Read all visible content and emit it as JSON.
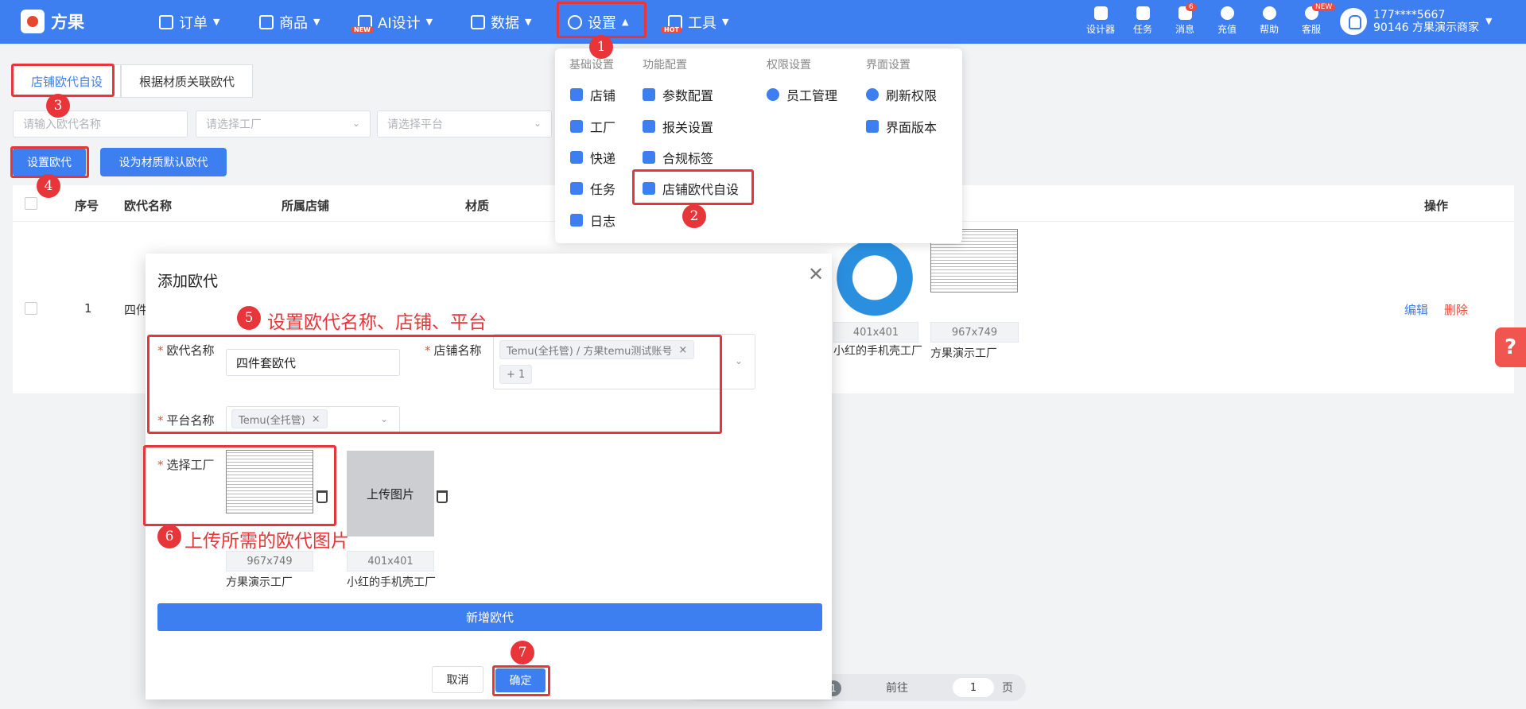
{
  "app": {
    "name": "方果"
  },
  "nav": {
    "items": [
      {
        "label": "订单"
      },
      {
        "label": "商品"
      },
      {
        "label": "AI设计",
        "badge": "NEW"
      },
      {
        "label": "数据"
      },
      {
        "label": "设置"
      },
      {
        "label": "工具",
        "badge": "HOT"
      }
    ],
    "right": [
      {
        "label": "设计器"
      },
      {
        "label": "任务"
      },
      {
        "label": "消息",
        "count": "6"
      },
      {
        "label": "充值"
      },
      {
        "label": "帮助"
      },
      {
        "label": "客服",
        "badge": "NEW"
      }
    ],
    "user": {
      "phone": "177****5667",
      "store": "90146 方果演示商家"
    }
  },
  "tabs": [
    "店铺欧代自设",
    "根据材质关联欧代"
  ],
  "filters": {
    "name_placeholder": "请输入欧代名称",
    "factory_placeholder": "请选择工厂",
    "platform_placeholder": "请选择平台"
  },
  "buttons": {
    "set_rep": "设置欧代",
    "set_default": "设为材质默认欧代"
  },
  "table": {
    "headers": [
      "序号",
      "欧代名称",
      "所属店铺",
      "材质",
      "操作"
    ],
    "row": {
      "index": "1",
      "name": "四件",
      "edit": "编辑",
      "delete": "删除",
      "images": [
        {
          "size": "401x401",
          "factory": "小红的手机壳工厂"
        },
        {
          "size": "967x749",
          "factory": "方果演示工厂"
        }
      ]
    }
  },
  "pager": {
    "page": "1",
    "goto_label": "前往",
    "goto_value": "1",
    "page_suffix": "页"
  },
  "menu": {
    "columns": [
      {
        "title": "基础设置",
        "items": [
          "店铺",
          "工厂",
          "快递",
          "任务",
          "日志"
        ]
      },
      {
        "title": "功能配置",
        "items": [
          "参数配置",
          "报关设置",
          "合规标签",
          "店铺欧代自设"
        ]
      },
      {
        "title": "权限设置",
        "items": [
          "员工管理"
        ]
      },
      {
        "title": "界面设置",
        "items": [
          "刷新权限",
          "界面版本"
        ]
      }
    ]
  },
  "dialog": {
    "title": "添加欧代",
    "rep_name_label": "欧代名称",
    "rep_name_value": "四件套欧代",
    "store_label": "店铺名称",
    "store_tag": "Temu(全托管) / 方果temu测试账号",
    "store_more": "+ 1",
    "platform_label": "平台名称",
    "platform_tag": "Temu(全托管)",
    "factory_label": "选择工厂",
    "upload_label": "上传图片",
    "images": [
      {
        "size": "967x749",
        "factory": "方果演示工厂"
      },
      {
        "size": "401x401",
        "factory": "小红的手机壳工厂"
      }
    ],
    "add_button": "新增欧代",
    "cancel": "取消",
    "confirm": "确定"
  },
  "annotations": {
    "steps": [
      "1",
      "2",
      "3",
      "4",
      "5",
      "6",
      "7"
    ],
    "note5": "设置欧代名称、店铺、平台",
    "note6": "上传所需的欧代图片",
    "color": "#e8353a"
  }
}
